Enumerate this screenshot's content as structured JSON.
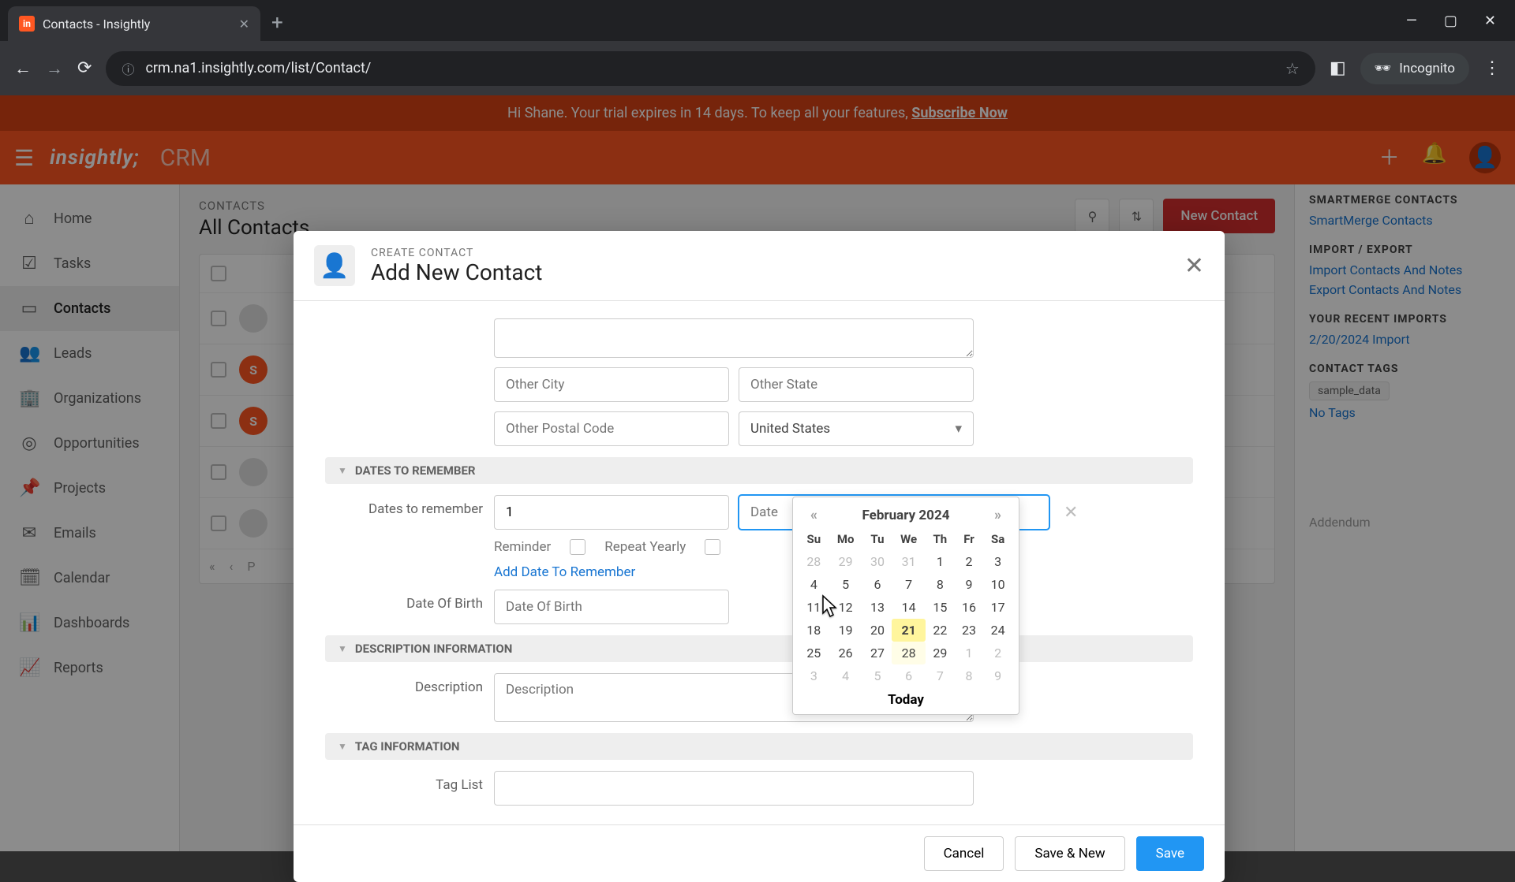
{
  "browser": {
    "tab_title": "Contacts - Insightly",
    "url": "crm.na1.insightly.com/list/Contact/",
    "incognito_label": "Incognito"
  },
  "banner": {
    "prefix": "Hi Shane. Your trial expires in 14 days. To keep all your features, ",
    "link": "Subscribe Now"
  },
  "app": {
    "name": "insightly",
    "product": "CRM"
  },
  "sidebar": {
    "items": [
      {
        "label": "Home"
      },
      {
        "label": "Tasks"
      },
      {
        "label": "Contacts"
      },
      {
        "label": "Leads"
      },
      {
        "label": "Organizations"
      },
      {
        "label": "Opportunities"
      },
      {
        "label": "Projects"
      },
      {
        "label": "Emails"
      },
      {
        "label": "Calendar"
      },
      {
        "label": "Dashboards"
      },
      {
        "label": "Reports"
      }
    ]
  },
  "list": {
    "subtitle": "CONTACTS",
    "title": "All Contacts",
    "new_button": "New Contact",
    "page_label": "P"
  },
  "rightcol": {
    "merge_title": "SMARTMERGE CONTACTS",
    "merge_link": "SmartMerge Contacts",
    "io_title": "IMPORT / EXPORT",
    "import_link": "Import Contacts And Notes",
    "export_link": "Export Contacts And Notes",
    "recent_title": "YOUR RECENT IMPORTS",
    "recent_link": "2/20/2024 Import",
    "tags_title": "CONTACT TAGS",
    "sample_tag": "sample_data",
    "notags": "No Tags",
    "addendum": "Addendum"
  },
  "modal": {
    "subtitle": "CREATE CONTACT",
    "title": "Add New Contact",
    "placeholders": {
      "other_city": "Other City",
      "other_state": "Other State",
      "other_postal": "Other Postal Code",
      "date": "Date",
      "dob": "Date Of Birth",
      "description": "Description"
    },
    "country": "United States",
    "sections": {
      "dates": "DATES TO REMEMBER",
      "description": "DESCRIPTION INFORMATION",
      "tags": "TAG INFORMATION"
    },
    "labels": {
      "dates_to_remember": "Dates to remember",
      "reminder": "Reminder",
      "repeat_yearly": "Repeat Yearly",
      "add_date": "Add Date To Remember",
      "dob": "Date Of Birth",
      "description": "Description",
      "tag_list": "Tag List"
    },
    "values": {
      "reminder_value": "1"
    },
    "buttons": {
      "cancel": "Cancel",
      "save_new": "Save & New",
      "save": "Save"
    }
  },
  "datepicker": {
    "month": "February 2024",
    "today_label": "Today",
    "dow": [
      "Su",
      "Mo",
      "Tu",
      "We",
      "Th",
      "Fr",
      "Sa"
    ],
    "weeks": [
      [
        {
          "d": "28",
          "other": true
        },
        {
          "d": "29",
          "other": true
        },
        {
          "d": "30",
          "other": true
        },
        {
          "d": "31",
          "other": true
        },
        {
          "d": "1"
        },
        {
          "d": "2"
        },
        {
          "d": "3"
        }
      ],
      [
        {
          "d": "4"
        },
        {
          "d": "5"
        },
        {
          "d": "6"
        },
        {
          "d": "7"
        },
        {
          "d": "8"
        },
        {
          "d": "9"
        },
        {
          "d": "10"
        }
      ],
      [
        {
          "d": "11"
        },
        {
          "d": "12"
        },
        {
          "d": "13"
        },
        {
          "d": "14"
        },
        {
          "d": "15"
        },
        {
          "d": "16"
        },
        {
          "d": "17"
        }
      ],
      [
        {
          "d": "18"
        },
        {
          "d": "19"
        },
        {
          "d": "20"
        },
        {
          "d": "21",
          "today": true
        },
        {
          "d": "22"
        },
        {
          "d": "23"
        },
        {
          "d": "24"
        }
      ],
      [
        {
          "d": "25"
        },
        {
          "d": "26"
        },
        {
          "d": "27"
        },
        {
          "d": "28",
          "highlight": true
        },
        {
          "d": "29"
        },
        {
          "d": "1",
          "other": true
        },
        {
          "d": "2",
          "other": true
        }
      ],
      [
        {
          "d": "3",
          "other": true
        },
        {
          "d": "4",
          "other": true
        },
        {
          "d": "5",
          "other": true
        },
        {
          "d": "6",
          "other": true
        },
        {
          "d": "7",
          "other": true
        },
        {
          "d": "8",
          "other": true
        },
        {
          "d": "9",
          "other": true
        }
      ]
    ]
  }
}
